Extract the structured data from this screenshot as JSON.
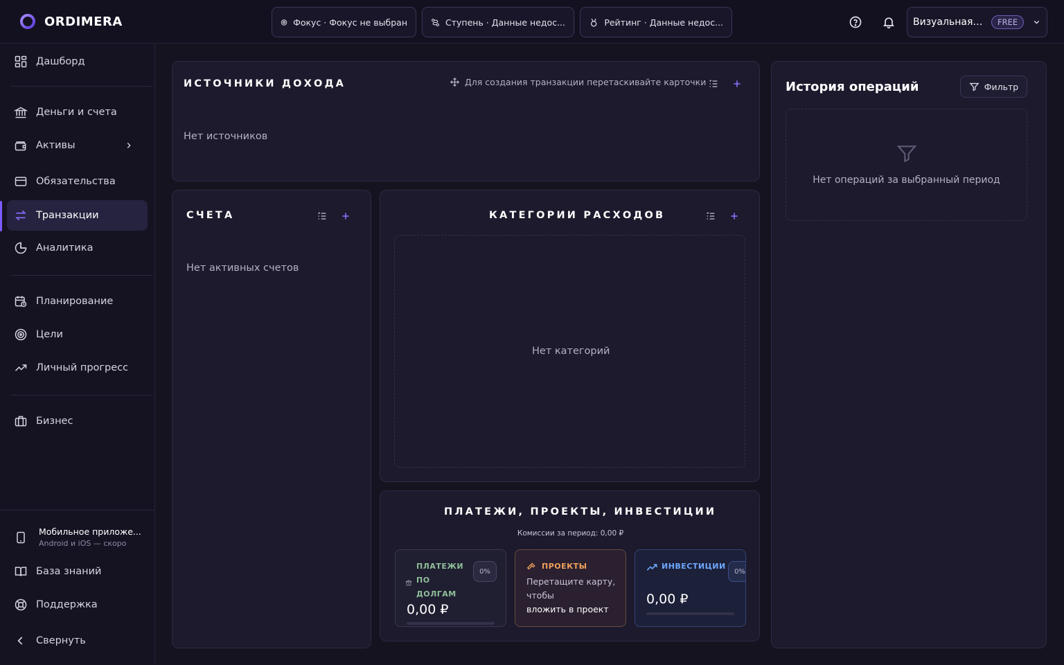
{
  "brand": {
    "name": "ORDIMERA",
    "accent": "#7c5cff"
  },
  "topbar": {
    "pills": [
      {
        "icon": "target-icon",
        "label": "Фокус · Фокус не выбран"
      },
      {
        "icon": "route-icon",
        "label": "Ступень · Данные недос..."
      },
      {
        "icon": "medal-icon",
        "label": "Рейтинг · Данные недос..."
      }
    ],
    "user": {
      "name": "Визуальная ...",
      "plan": "FREE"
    }
  },
  "sidebar": {
    "items": [
      {
        "id": "dashboard",
        "icon": "grid-icon",
        "label": "Дашборд"
      },
      {
        "id": "money",
        "icon": "bank-icon",
        "label": "Деньги и счета"
      },
      {
        "id": "assets",
        "icon": "wallet-icon",
        "label": "Активы"
      },
      {
        "id": "liabilities",
        "icon": "card-icon",
        "label": "Обязательства"
      },
      {
        "id": "transactions",
        "icon": "transfer-icon",
        "label": "Транзакции",
        "active": true
      },
      {
        "id": "analytics",
        "icon": "pie-icon",
        "label": "Аналитика"
      },
      {
        "id": "planning",
        "icon": "calendar-icon",
        "label": "Планирование"
      },
      {
        "id": "goals",
        "icon": "target-icon",
        "label": "Цели"
      },
      {
        "id": "progress",
        "icon": "trend-icon",
        "label": "Личный прогресс"
      },
      {
        "id": "business",
        "icon": "briefcase-icon",
        "label": "Бизнес"
      }
    ],
    "mobile": {
      "title": "Мобильное приложе...",
      "subtitle": "Android и iOS — скоро"
    },
    "knowledge": "База знаний",
    "support": "Поддержка",
    "collapse": "Свернуть"
  },
  "income": {
    "title": "ИСТОЧНИКИ ДОХОДА",
    "hint": "Для создания транзакции перетаскивайте карточки",
    "empty": "Нет источников"
  },
  "accounts": {
    "title": "СЧЕТА",
    "empty": "Нет активных счетов"
  },
  "expenses": {
    "title": "КАТЕГОРИИ РАСХОДОВ",
    "empty": "Нет категорий"
  },
  "payments": {
    "title": "ПЛАТЕЖИ, ПРОЕКТЫ, ИНВЕСТИЦИИ",
    "commission": "Комиссии за период: 0,00 ₽",
    "debt": {
      "title_line1": "ПЛАТЕЖИ",
      "title_line2": "ПО",
      "title_line3": "ДОЛГАМ",
      "pct": "0%",
      "amount": "0,00 ₽",
      "color": "#8fbf99"
    },
    "projects": {
      "title": "ПРОЕКТЫ",
      "text_line1": "Перетащите карту,",
      "text_line2": "чтобы",
      "text_line3": "вложить в проект",
      "color": "#f0a15a"
    },
    "investments": {
      "title": "ИНВЕСТИЦИИ",
      "pct": "0%",
      "amount": "0,00 ₽",
      "color": "#6ea8ff"
    }
  },
  "history": {
    "title": "История операций",
    "filter": "Фильтр",
    "empty": "Нет операций за выбранный период"
  }
}
